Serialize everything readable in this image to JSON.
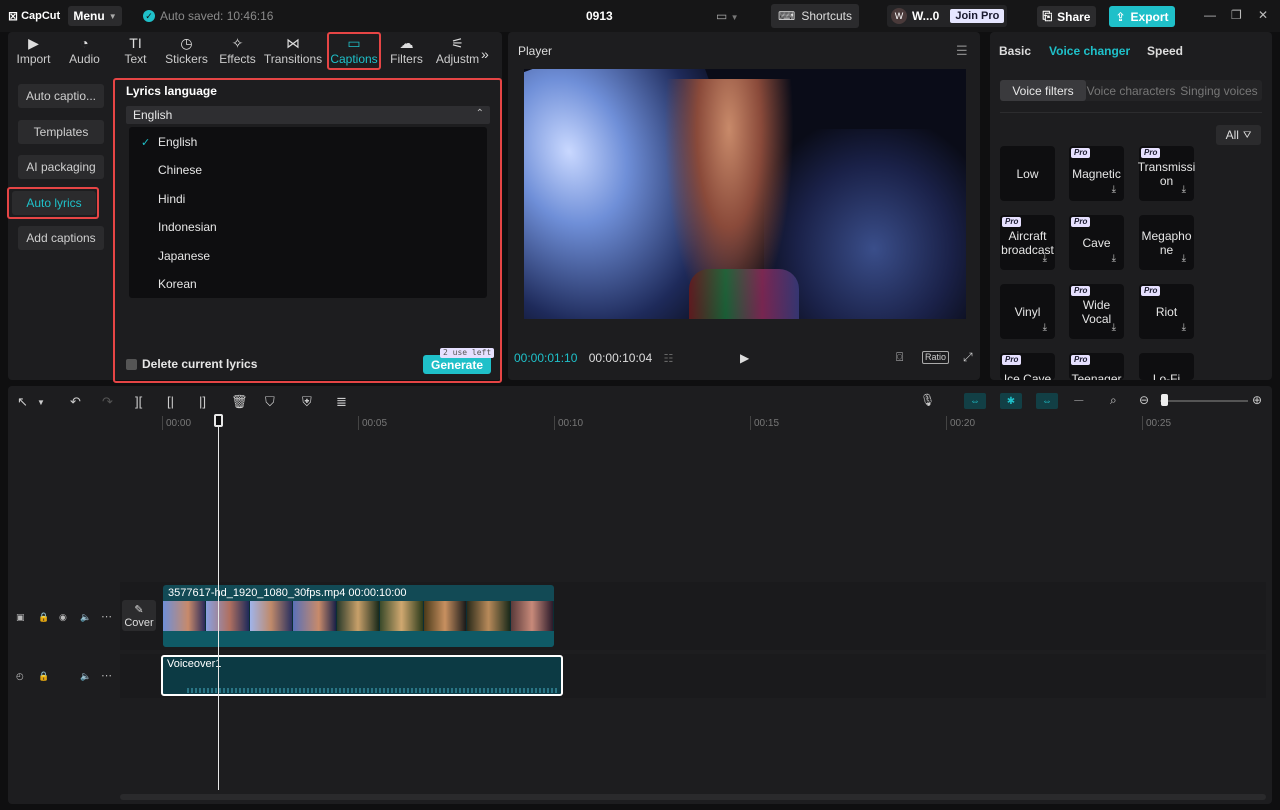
{
  "app": {
    "logo": "CapCut",
    "menu_label": "Menu",
    "autosave": "Auto saved: 10:46:16",
    "project_title": "0913",
    "shortcuts_label": "Shortcuts",
    "account_name": "W...0",
    "avatar_letter": "W",
    "join_pro": "Join Pro",
    "share_label": "Share",
    "export_label": "Export",
    "accent_color": "#1fc0c9"
  },
  "toolbar": {
    "tools": [
      {
        "icon": "import-icon",
        "label": "Import"
      },
      {
        "icon": "audio-icon",
        "label": "Audio"
      },
      {
        "icon": "text-icon",
        "label": "Text"
      },
      {
        "icon": "stickers-icon",
        "label": "Stickers"
      },
      {
        "icon": "effects-icon",
        "label": "Effects"
      },
      {
        "icon": "transitions-icon",
        "label": "Transitions"
      },
      {
        "icon": "captions-icon",
        "label": "Captions"
      },
      {
        "icon": "filters-icon",
        "label": "Filters"
      },
      {
        "icon": "adjustment-icon",
        "label": "Adjustm"
      }
    ],
    "active": "Captions",
    "text_icon_glyph": "TI"
  },
  "captions_sidebar": {
    "items": [
      "Auto captio...",
      "Templates",
      "AI packaging",
      "Auto lyrics",
      "Add captions"
    ],
    "active": "Auto lyrics"
  },
  "lyrics": {
    "title": "Lyrics language",
    "selected": "English",
    "options": [
      "English",
      "Chinese",
      "Hindi",
      "Indonesian",
      "Japanese",
      "Korean"
    ],
    "delete_label": "Delete current lyrics",
    "uses_left": "2 use left",
    "generate_label": "Generate"
  },
  "player": {
    "title": "Player",
    "current_time": "00:00:01:10",
    "total_time": "00:00:10:04",
    "ratio_label": "Ratio"
  },
  "right_panel": {
    "tabs": [
      "Basic",
      "Voice changer",
      "Speed"
    ],
    "active_tab": "Voice changer",
    "subtabs": [
      "Voice filters",
      "Voice characters",
      "Singing voices"
    ],
    "active_subtab": "Voice filters",
    "filter_label": "All",
    "pro_badge": "Pro",
    "voices": [
      {
        "name": "Low",
        "pro": false,
        "download": false
      },
      {
        "name": "Magnetic",
        "pro": true,
        "download": true
      },
      {
        "name": "Transmissi on",
        "pro": true,
        "download": true
      },
      {
        "name": "Aircraft broadcast",
        "pro": true,
        "download": true
      },
      {
        "name": "Cave",
        "pro": true,
        "download": true
      },
      {
        "name": "Megapho ne",
        "pro": false,
        "download": true
      },
      {
        "name": "Vinyl",
        "pro": false,
        "download": true
      },
      {
        "name": "Wide Vocal",
        "pro": true,
        "download": true
      },
      {
        "name": "Riot",
        "pro": true,
        "download": true
      },
      {
        "name": "Ice Cave",
        "pro": true,
        "download": false
      },
      {
        "name": "Teenager",
        "pro": true,
        "download": false
      },
      {
        "name": "Lo-Fi",
        "pro": false,
        "download": false
      }
    ]
  },
  "timeline": {
    "ruler_labels": [
      "00:00",
      "00:05",
      "00:10",
      "00:15",
      "00:20",
      "00:25"
    ],
    "cover_label": "Cover",
    "video_clip_label": "3577617-hd_1920_1080_30fps.mp4   00:00:10:00",
    "voice_clip_label": "Voiceover1"
  }
}
